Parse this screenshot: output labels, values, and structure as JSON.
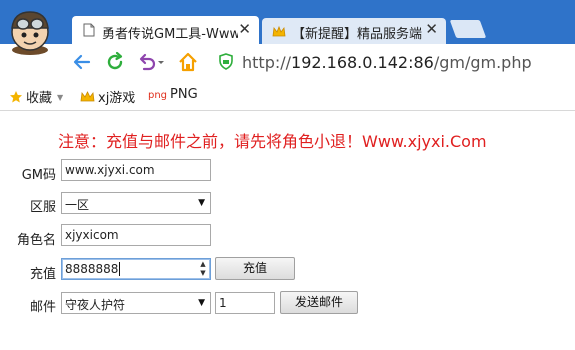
{
  "browser": {
    "tabs": [
      {
        "title": "勇者传说GM工具-Www",
        "close": "✕",
        "active": true
      },
      {
        "title": "【新提醒】精品服务端",
        "close": "✕",
        "active": false
      }
    ],
    "url_prefix": "http://",
    "url_host": "192.168.0.142:86",
    "url_path": "/gm/gm.php",
    "bookmarks": [
      {
        "label": "收藏",
        "icon": "star-icon"
      },
      {
        "label": "xj游戏",
        "icon": "crown-icon"
      },
      {
        "label": "PNG",
        "prefix": "png",
        "icon": "png-icon"
      }
    ],
    "accent": "#2f73c9"
  },
  "page": {
    "notice": "注意：充值与邮件之前，请先将角色小退！Www.xjyxi.Com",
    "notice_color": "#e02020",
    "form": {
      "gm_label": "GM码",
      "gm_value": "www.xjyxi.com",
      "server_label": "区服",
      "server_value": "一区",
      "role_label": "角色名",
      "role_value": "xjyxicom",
      "recharge_label": "充值",
      "recharge_value": "8888888",
      "recharge_button": "充值",
      "mail_label": "邮件",
      "mail_item": "守夜人护符",
      "mail_qty": "1",
      "mail_button": "发送邮件"
    }
  }
}
